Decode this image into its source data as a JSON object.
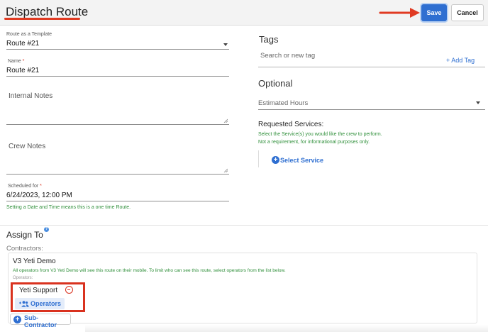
{
  "header": {
    "title": "Dispatch Route",
    "save_label": "Save",
    "cancel_label": "Cancel",
    "accent_color": "#e03a22",
    "primary_color": "#2f6fd1"
  },
  "form": {
    "template": {
      "label": "Route as a Template",
      "value": "Route #21"
    },
    "name": {
      "label": "Name",
      "required_mark": "*",
      "value": "Route #21"
    },
    "internal_notes": {
      "placeholder": "Internal Notes"
    },
    "crew_notes": {
      "placeholder": "Crew Notes"
    },
    "scheduled": {
      "label": "Scheduled for",
      "required_mark": "*",
      "value": "6/24/2023, 12:00 PM",
      "hint": "Setting a Date and Time means this is a one time Route."
    }
  },
  "tags": {
    "title": "Tags",
    "search_placeholder": "Search or new tag",
    "add_label": "+ Add Tag"
  },
  "optional": {
    "title": "Optional",
    "hours_placeholder": "Estimated Hours",
    "services_title": "Requested Services:",
    "services_hint_1": "Select the Service(s) you would like the crew to perform.",
    "services_hint_2": "Not a requirement, for informational purposes only.",
    "select_service_label": "Select Service"
  },
  "assign": {
    "title": "Assign To",
    "help_icon": "?",
    "contractors_label": "Contractors:",
    "company": "V3 Yeti Demo",
    "company_hint": "All operators from V3 Yeti Demo will see this route on their mobile. To limit who can see this route, select operators from the list below.",
    "operators_label": "Operators:",
    "operator_name": "Yeti Support",
    "operators_button": "Operators",
    "sub_contractor_button": "Sub-Contractor"
  }
}
